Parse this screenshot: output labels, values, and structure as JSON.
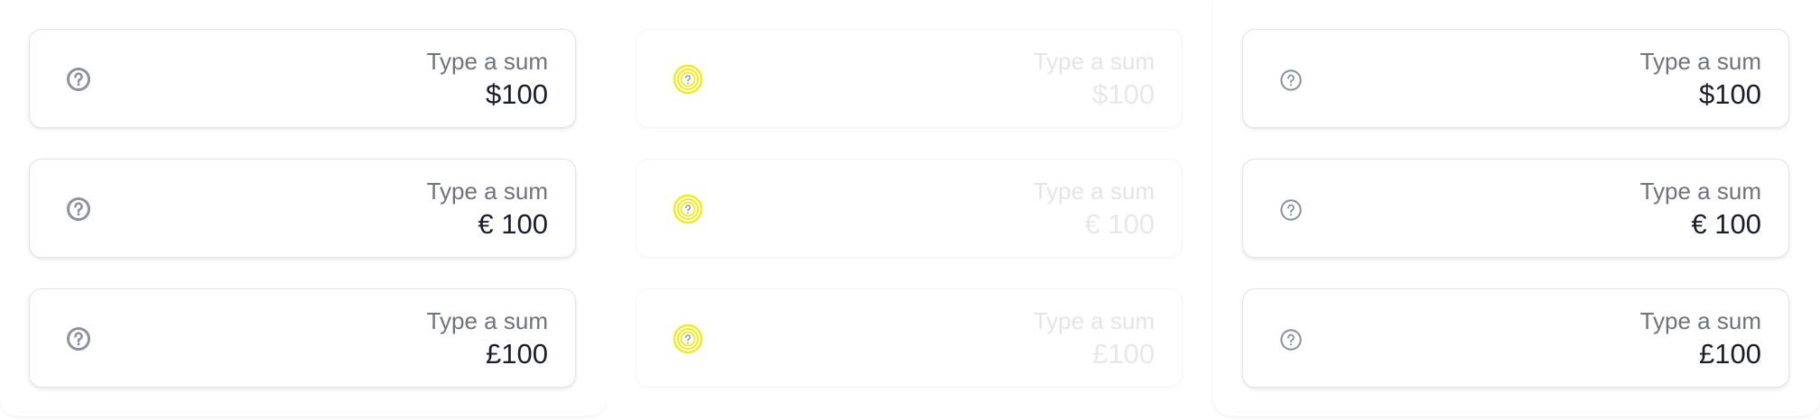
{
  "panels": [
    {
      "state": "default",
      "fields": [
        {
          "label": "Type a sum",
          "value": "$100",
          "icon": "help-circle-icon"
        },
        {
          "label": "Type a sum",
          "value": "€ 100",
          "icon": "help-circle-icon"
        },
        {
          "label": "Type a sum",
          "value": "£100",
          "icon": "help-circle-icon"
        }
      ]
    },
    {
      "state": "disabled",
      "fields": [
        {
          "label": "Type a sum",
          "value": "$100",
          "icon": "help-circle-icon-highlighted"
        },
        {
          "label": "Type a sum",
          "value": "€ 100",
          "icon": "help-circle-icon-highlighted"
        },
        {
          "label": "Type a sum",
          "value": "£100",
          "icon": "help-circle-icon-highlighted"
        }
      ]
    },
    {
      "state": "default",
      "fields": [
        {
          "label": "Type a sum",
          "value": "$100",
          "icon": "help-circle-icon"
        },
        {
          "label": "Type a sum",
          "value": "€ 100",
          "icon": "help-circle-icon"
        },
        {
          "label": "Type a sum",
          "value": "£100",
          "icon": "help-circle-icon"
        }
      ]
    }
  ],
  "colors": {
    "label": "#6f737f",
    "value": "#1a1d2c",
    "icon": "#8e929c",
    "highlight": "#f2ea1a",
    "border": "#e2e4ea"
  }
}
